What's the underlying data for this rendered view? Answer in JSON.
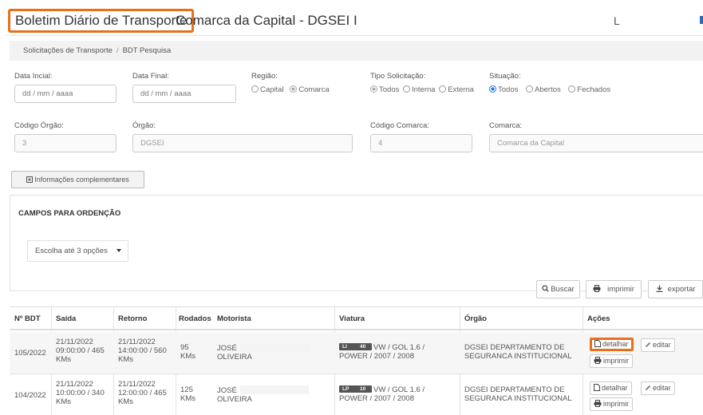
{
  "header": {
    "title": "Boletim Diário de Transporte",
    "subtitle": "Comarca da Capital - DGSEI I",
    "right_letter": "L"
  },
  "breadcrumb": [
    "Solicitações de Transporte",
    "BDT Pesquisa"
  ],
  "filters": {
    "data_inicial": {
      "label": "Data Incial:",
      "value": "dd / mm / aaaa"
    },
    "data_final": {
      "label": "Data Final:",
      "value": "dd / mm / aaaa"
    },
    "regiao": {
      "label": "Região:",
      "options": [
        "Capital",
        "Comarca"
      ],
      "selected": "Comarca"
    },
    "tipo": {
      "label": "Tipo Solicitação:",
      "options": [
        "Todos",
        "Interna",
        "Externa"
      ],
      "selected": "Todos"
    },
    "situacao": {
      "label": "Situação:",
      "options": [
        "Todos",
        "Abertos",
        "Fechados"
      ],
      "selected": "Todos"
    },
    "codigo_orgao": {
      "label": "Código Órgão:",
      "value": "3"
    },
    "orgao": {
      "label": "Órgão:",
      "value": "DGSEI"
    },
    "codigo_comarca": {
      "label": "Código Comarca:",
      "value": "4"
    },
    "comarca": {
      "label": "Comarca:",
      "value": "Comarca da Capital"
    }
  },
  "info_button": "Informações complementares",
  "ordering": {
    "title": "CAMPOS PARA ORDENÇÃO",
    "select_placeholder": "Escolha até 3 opções"
  },
  "toolbar": {
    "buscar": "Buscar",
    "imprimir": "imprimir",
    "exportar": "exportar"
  },
  "table": {
    "headers": [
      "Nº BDT",
      "Saída",
      "Retorno",
      "Rodados",
      "Motorista",
      "Viatura",
      "Órgão",
      "Ações"
    ],
    "rows": [
      {
        "bdt": "105/2022",
        "saida": [
          "21/11/2022",
          "09:00:00 / 465",
          "KMs"
        ],
        "retorno": [
          "21/11/2022",
          "14:00:00 / 560",
          "KMs"
        ],
        "rodados": [
          "95",
          "KMs"
        ],
        "motorista": [
          "JOSÉ",
          "OLIVEIRA"
        ],
        "plate": [
          "LI",
          "40"
        ],
        "viatura": [
          "VW / GOL 1.6 /",
          "POWER / 2007 / 2008"
        ],
        "orgao": [
          "DGSEI DEPARTAMENTO DE",
          "SEGURANCA INSTITUCIONAL"
        ]
      },
      {
        "bdt": "104/2022",
        "saida": [
          "21/11/2022",
          "10:00:00 / 340",
          "KMs"
        ],
        "retorno": [
          "21/11/2022",
          "12:00:00 / 465",
          "KMs"
        ],
        "rodados": [
          "125",
          "KMs"
        ],
        "motorista": [
          "JOSÉ",
          "OLIVEIRA"
        ],
        "plate": [
          "LP",
          "10"
        ],
        "viatura": [
          "VW / GOL 1.6 /",
          "POWER / 2007 / 2008"
        ],
        "orgao": [
          "DGSEI DEPARTAMENTO DE",
          "SEGURANCA INSTITUCIONAL"
        ]
      }
    ],
    "actions": {
      "detalhar": "detalhar",
      "editar": "editar",
      "imprimir": "imprimir"
    }
  }
}
